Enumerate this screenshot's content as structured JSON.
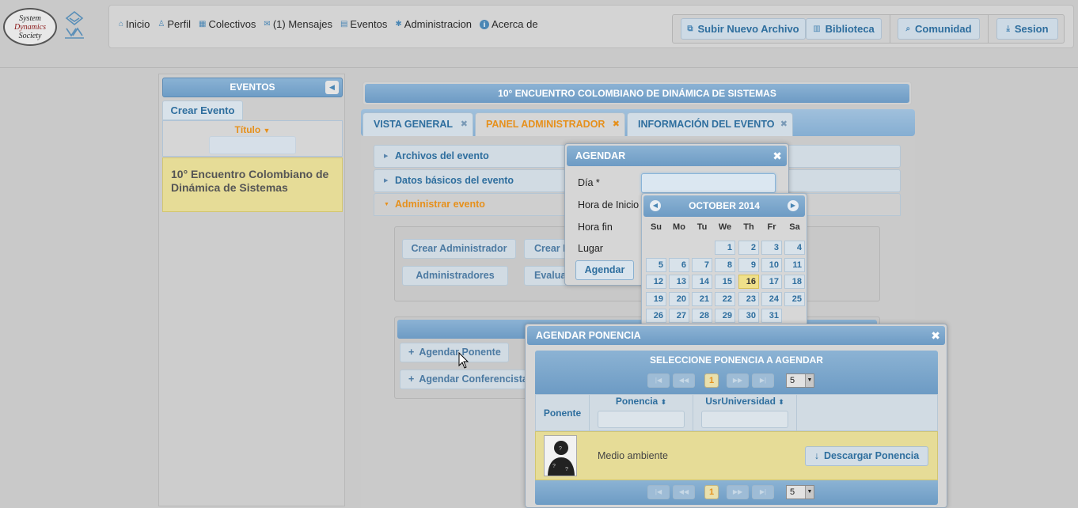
{
  "logo": {
    "line1": "System",
    "line2": "Dynamics",
    "line3": "Society"
  },
  "nav": {
    "links": [
      {
        "label": "Inicio",
        "icon": "home-icon"
      },
      {
        "label": "Perfil",
        "icon": "person-icon"
      },
      {
        "label": "Colectivos",
        "icon": "grid-icon"
      },
      {
        "label": "(1) Mensajes",
        "icon": "mail-icon"
      },
      {
        "label": "Eventos",
        "icon": "calendar-icon"
      },
      {
        "label": "Administracion",
        "icon": "gear-icon"
      },
      {
        "label": "Acerca de",
        "icon": "info-icon"
      }
    ],
    "actions": {
      "upload": "Subir Nuevo Archivo",
      "library": "Biblioteca",
      "community": "Comunidad",
      "session": "Sesion"
    }
  },
  "sidebar": {
    "header": "EVENTOS",
    "create_button": "Crear Evento",
    "column_title": "Título",
    "events": [
      "10° Encuentro Colombiano de Dinámica de Sistemas"
    ]
  },
  "main": {
    "title": "10° ENCUENTRO COLOMBIANO DE DINÁMICA DE SISTEMAS",
    "tabs": [
      {
        "label": "VISTA GENERAL",
        "active": false
      },
      {
        "label": "PANEL ADMINISTRADOR",
        "active": true
      },
      {
        "label": "INFORMACIÓN DEL EVENTO",
        "active": false
      }
    ],
    "accordion": [
      {
        "label": "Archivos del evento",
        "open": false
      },
      {
        "label": "Datos básicos del evento",
        "open": false
      },
      {
        "label": "Administrar evento",
        "open": true
      }
    ],
    "admin_buttons": {
      "crear_admin": "Crear Administrador",
      "crear_partial": "Crear E",
      "administradores": "Administradores",
      "evalua_partial": "Evalua"
    },
    "schedule_buttons": {
      "agendar_ponente": "Agendar Ponente",
      "agendar_conferencista": "Agendar Conferencista"
    }
  },
  "agendar_dialog": {
    "title": "AGENDAR",
    "fields": {
      "dia": "Día *",
      "hora_inicio": "Hora de Inicio",
      "hora_fin": "Hora fin",
      "lugar": "Lugar"
    },
    "dia_value": "",
    "submit": "Agendar"
  },
  "calendar": {
    "month_label": "OCTOBER 2014",
    "weekdays": [
      "Su",
      "Mo",
      "Tu",
      "We",
      "Th",
      "Fr",
      "Sa"
    ],
    "first_weekday_index": 3,
    "days_in_month": 31,
    "today": 16
  },
  "ponencia_dialog": {
    "title": "AGENDAR PONENCIA",
    "table_caption": "SELECCIONE PONENCIA A AGENDAR",
    "current_page": "1",
    "rows_per_page": "5",
    "columns": {
      "ponente": "Ponente",
      "ponencia": "Ponencia",
      "universidad": "UsrUniversidad"
    },
    "rows": [
      {
        "ponencia": "Medio ambiente",
        "action": "Descargar Ponencia"
      }
    ]
  }
}
